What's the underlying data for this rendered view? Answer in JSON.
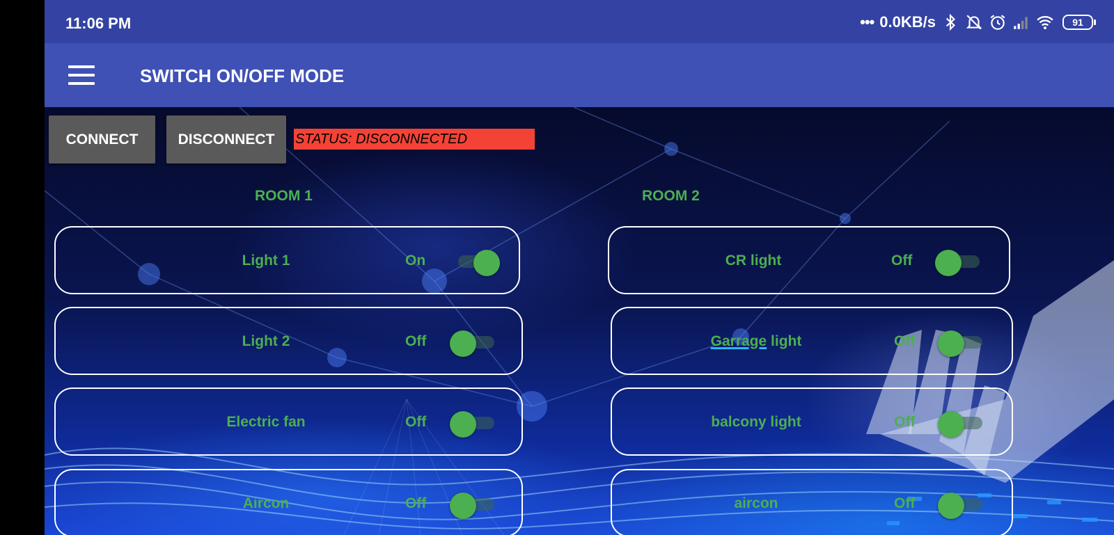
{
  "status_bar": {
    "time": "11:06 PM",
    "network_speed": "0.0KB/s",
    "battery_level": "91",
    "icons": [
      "dots-icon",
      "bluetooth-icon",
      "muted-bell-icon",
      "alarm-icon",
      "signal-icon",
      "wifi-icon",
      "battery-icon"
    ]
  },
  "app_bar": {
    "menu_icon": "hamburger-menu-icon",
    "title": "SWITCH ON/OFF MODE"
  },
  "controls": {
    "connect_label": "CONNECT",
    "disconnect_label": "DISCONNECT",
    "status_text": "STATUS: DISCONNECTED",
    "status_color": "#f44336"
  },
  "rooms": [
    {
      "label": "ROOM 1",
      "switches": [
        {
          "name": "Light 1",
          "state": "On",
          "on": true
        },
        {
          "name": "Light 2",
          "state": "Off",
          "on": false
        },
        {
          "name": "Electric fan",
          "state": "Off",
          "on": false
        },
        {
          "name": "Aircon",
          "state": "Off",
          "on": false
        }
      ]
    },
    {
      "label": "ROOM 2",
      "switches": [
        {
          "name": "CR light",
          "state": "Off",
          "on": false
        },
        {
          "name_underlined": "Garrage",
          "name_rest": " light",
          "state": "Off",
          "on": false
        },
        {
          "name": "balcony light",
          "state": "Off",
          "on": false
        },
        {
          "name": "aircon",
          "state": "Off",
          "on": false
        }
      ]
    }
  ],
  "colors": {
    "accent_green": "#4caf50",
    "app_bar": "#3f51b5",
    "status_bar": "#3342a3",
    "button_gray": "#5a5a5a"
  }
}
